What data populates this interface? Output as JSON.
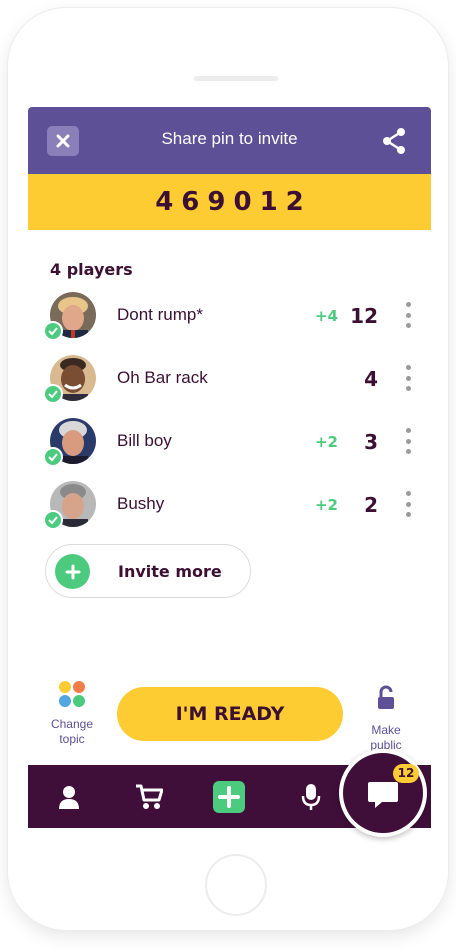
{
  "header": {
    "title": "Share pin to invite",
    "close_icon": "close-icon",
    "share_icon": "share-icon"
  },
  "pin": {
    "value": "469012"
  },
  "players": {
    "count_label": "4 players",
    "items": [
      {
        "name": "Dont rump*",
        "delta": "+4",
        "score": "12",
        "ready": true
      },
      {
        "name": "Oh Bar rack",
        "delta": "",
        "score": "4",
        "ready": true
      },
      {
        "name": "Bill boy",
        "delta": "+2",
        "score": "3",
        "ready": true
      },
      {
        "name": "Bushy",
        "delta": "+2",
        "score": "2",
        "ready": true
      }
    ]
  },
  "invite": {
    "label": "Invite more"
  },
  "actions": {
    "change_topic": "Change topic",
    "ready": "I'M READY",
    "make_public": "Make public"
  },
  "nav": {
    "items": [
      "profile-icon",
      "cart-icon",
      "add-icon",
      "microphone-icon",
      "chat-icon"
    ],
    "chat_badge": "12"
  },
  "colors": {
    "purple": "#5e5096",
    "yellow": "#fdcc33",
    "dark": "#3f0f3a",
    "green": "#4ccb7f"
  }
}
